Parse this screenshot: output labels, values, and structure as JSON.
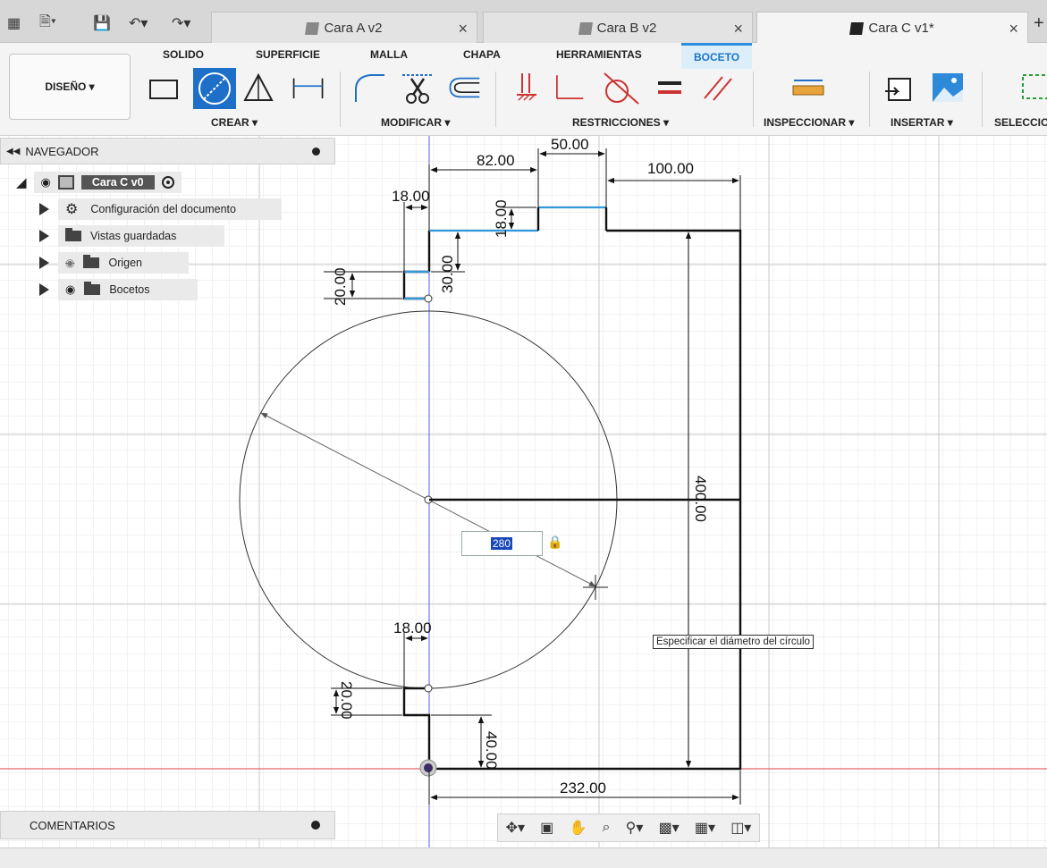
{
  "tabs": [
    {
      "label": "Cara A v2",
      "active": false
    },
    {
      "label": "Cara B v2",
      "active": false
    },
    {
      "label": "Cara C v1*",
      "active": true
    }
  ],
  "ribbon": {
    "tabs": [
      "SOLIDO",
      "SUPERFICIE",
      "MALLA",
      "CHAPA",
      "HERRAMIENTAS",
      "BOCETO"
    ],
    "active_tab": "BOCETO",
    "workspace": "DISEÑO ▾",
    "groups": [
      "CREAR ▾",
      "MODIFICAR ▾",
      "RESTRICCIONES ▾",
      "INSPECCIONAR ▾",
      "INSERTAR ▾",
      "SELECCIO"
    ]
  },
  "navigator": {
    "title": "NAVEGADOR",
    "root": "Cara C v0",
    "items": [
      {
        "label": "Configuración del documento",
        "icon": "gear-icon"
      },
      {
        "label": "Vistas guardadas",
        "icon": "folder-icon"
      },
      {
        "label": "Origen",
        "icon": "folder-icon",
        "hidden": true
      },
      {
        "label": "Bocetos",
        "icon": "folder-icon"
      }
    ]
  },
  "comments": {
    "title": "COMENTARIOS"
  },
  "sketch": {
    "dimensions": [
      "82.00",
      "50.00",
      "100.00",
      "18.00",
      "18.00",
      "30.00",
      "20.00",
      "400.00",
      "18.00",
      "20.00",
      "40.00",
      "232.00"
    ],
    "input_value": "280",
    "tooltip": "Especificar el diámetro del círculo"
  },
  "colors": {
    "accent": "#1e6fc7",
    "x_axis": "#d94545",
    "y_axis": "#5a5ae6",
    "sketch_line": "#111111",
    "constrained": "#3399dd"
  }
}
